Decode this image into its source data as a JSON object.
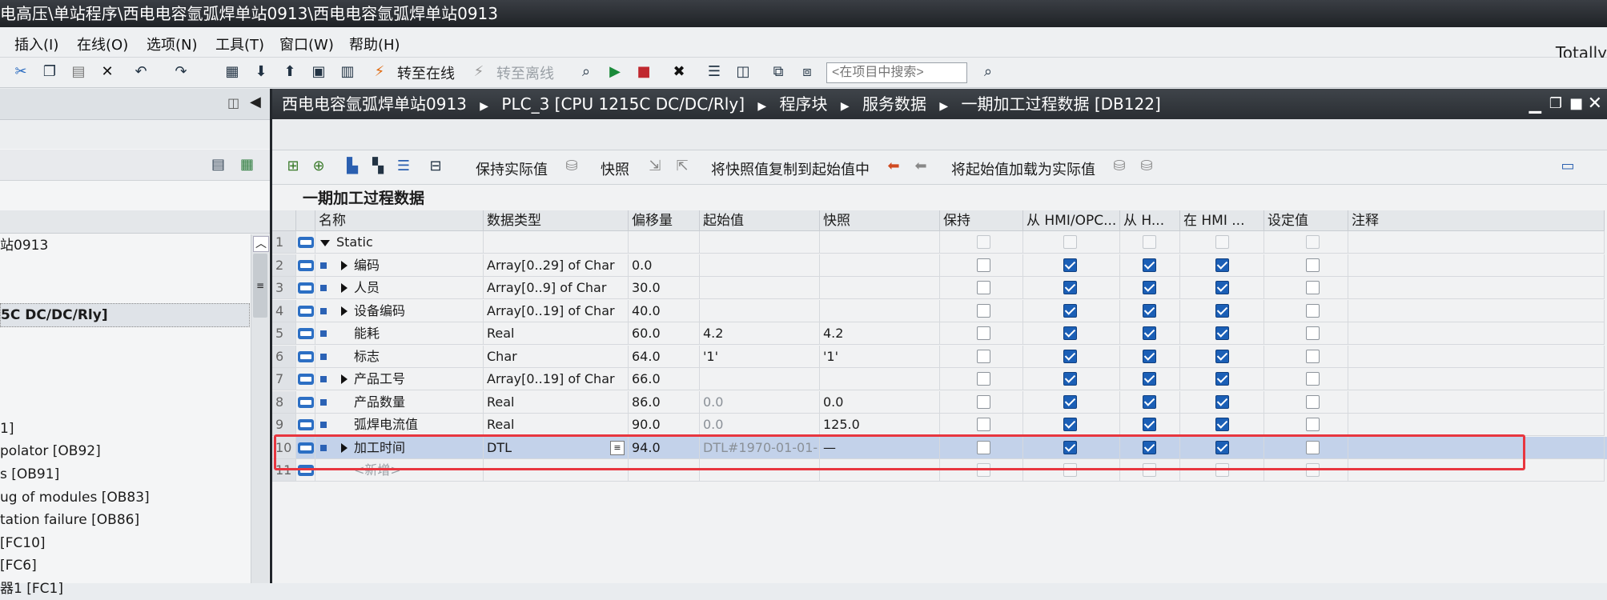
{
  "window": {
    "title": "电高压\\单站程序\\西电电容氩弧焊单站0913\\西电电容氩弧焊单站0913",
    "brand": "Totally"
  },
  "menu": [
    "插入(I)",
    "在线(O)",
    "选项(N)",
    "工具(T)",
    "窗口(W)",
    "帮助(H)"
  ],
  "toolbar": {
    "go_online": "转至在线",
    "go_offline": "转至离线",
    "search_placeholder": "<在项目中搜索>"
  },
  "project_tree": {
    "rows": [
      "站0913",
      "",
      "",
      "5C DC/DC/Rly]",
      "",
      "",
      "",
      "",
      "1]",
      "polator [OB92]",
      "s [OB91]",
      "ug of modules [OB83]",
      "tation failure [OB86]",
      " [FC10]",
      " [FC6]",
      "器1 [FC1]"
    ]
  },
  "editor": {
    "breadcrumb": [
      "西电电容氩弧焊单站0913",
      "PLC_3 [CPU 1215C DC/DC/Rly]",
      "程序块",
      "服务数据",
      "一期加工过程数据 [DB122]"
    ],
    "toolbar": {
      "keep_actual": "保持实际值",
      "snapshot": "快照",
      "copy_snapshot": "将快照值复制到起始值中",
      "load_start": "将起始值加载为实际值"
    },
    "block_name": "一期加工过程数据",
    "columns": [
      "名称",
      "数据类型",
      "偏移量",
      "起始值",
      "快照",
      "保持",
      "从 HMI/OPC...",
      "从 H...",
      "在 HMI ...",
      "设定值",
      "注释"
    ],
    "rows": [
      {
        "num": "1",
        "name": "Static",
        "type": "",
        "offset": "",
        "start": "",
        "snap": "",
        "retain": false,
        "hmi1": false,
        "hmi2": false,
        "hmi3": false,
        "setp": false,
        "expand": "down",
        "dim": true
      },
      {
        "num": "2",
        "name": "编码",
        "type": "Array[0..29] of Char",
        "offset": "0.0",
        "start": "",
        "snap": "",
        "retain": false,
        "hmi1": true,
        "hmi2": true,
        "hmi3": true,
        "setp": false,
        "expand": "right"
      },
      {
        "num": "3",
        "name": "人员",
        "type": "Array[0..9] of Char",
        "offset": "30.0",
        "start": "",
        "snap": "",
        "retain": false,
        "hmi1": true,
        "hmi2": true,
        "hmi3": true,
        "setp": false,
        "expand": "right"
      },
      {
        "num": "4",
        "name": "设备编码",
        "type": "Array[0..19] of Char",
        "offset": "40.0",
        "start": "",
        "snap": "",
        "retain": false,
        "hmi1": true,
        "hmi2": true,
        "hmi3": true,
        "setp": false,
        "expand": "right"
      },
      {
        "num": "5",
        "name": "能耗",
        "type": "Real",
        "offset": "60.0",
        "start": "4.2",
        "snap": "4.2",
        "retain": false,
        "hmi1": true,
        "hmi2": true,
        "hmi3": true,
        "setp": false,
        "expand": ""
      },
      {
        "num": "6",
        "name": "标志",
        "type": "Char",
        "offset": "64.0",
        "start": "'1'",
        "snap": "'1'",
        "retain": false,
        "hmi1": true,
        "hmi2": true,
        "hmi3": true,
        "setp": false,
        "expand": ""
      },
      {
        "num": "7",
        "name": "产品工号",
        "type": "Array[0..19] of Char",
        "offset": "66.0",
        "start": "",
        "snap": "",
        "retain": false,
        "hmi1": true,
        "hmi2": true,
        "hmi3": true,
        "setp": false,
        "expand": "right"
      },
      {
        "num": "8",
        "name": "产品数量",
        "type": "Real",
        "offset": "86.0",
        "start": "0.0",
        "snap": "0.0",
        "retain": false,
        "hmi1": true,
        "hmi2": true,
        "hmi3": true,
        "setp": false,
        "expand": "",
        "startGray": true
      },
      {
        "num": "9",
        "name": "弧焊电流值",
        "type": "Real",
        "offset": "90.0",
        "start": "0.0",
        "snap": "125.0",
        "retain": false,
        "hmi1": true,
        "hmi2": true,
        "hmi3": true,
        "setp": false,
        "expand": "",
        "startGray": true
      },
      {
        "num": "10",
        "name": "加工时间",
        "type": "DTL",
        "offset": "94.0",
        "start": "DTL#1970-01-01-",
        "snap": "—",
        "retain": false,
        "hmi1": true,
        "hmi2": true,
        "hmi3": true,
        "setp": false,
        "expand": "right",
        "selected": true,
        "startGray": true
      },
      {
        "num": "11",
        "name": "<新增>",
        "type": "",
        "offset": "",
        "start": "",
        "snap": "",
        "retain": false,
        "hmi1": false,
        "hmi2": false,
        "hmi3": false,
        "setp": false,
        "expand": "",
        "dim": true,
        "add": true
      }
    ]
  },
  "colors": {
    "accent": "#1b5fb6",
    "highlight_border": "#e8363f",
    "selected_row": "#c3d2ea",
    "title_bar": "#2a2e33"
  }
}
